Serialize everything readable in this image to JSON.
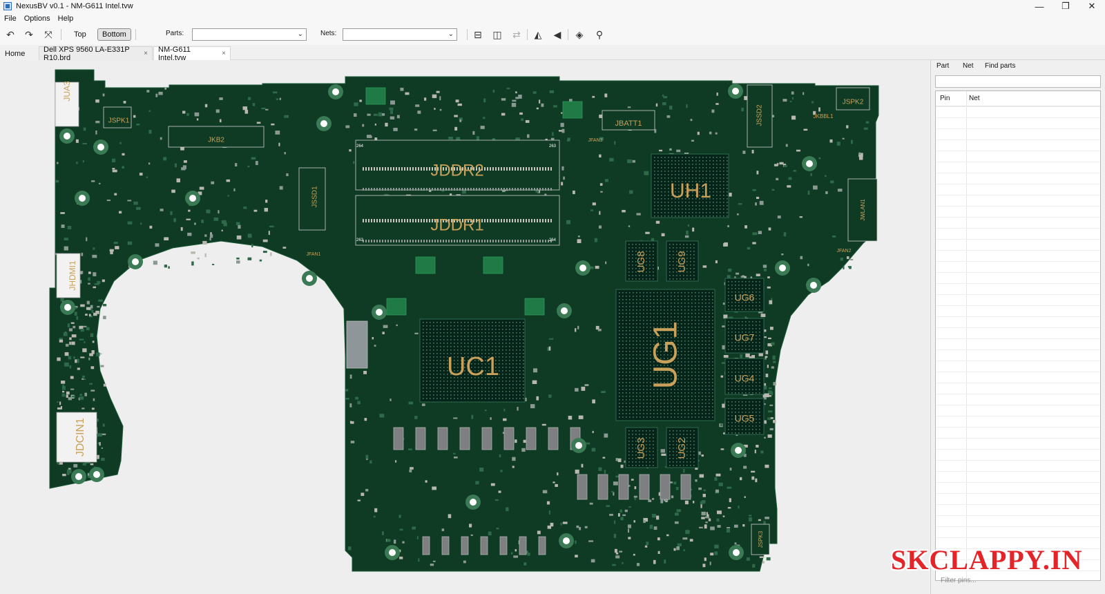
{
  "window": {
    "title": "NexusBV v0.1 - NM-G611 Intel.tvw",
    "minimize": "—",
    "maximize": "❐",
    "close": "✕"
  },
  "menu": [
    "File",
    "Options",
    "Help"
  ],
  "toolbar": {
    "undo_icon": "↶",
    "redo_icon": "↷",
    "fit_icon": "⤧",
    "top_label": "Top",
    "bottom_label": "Bottom",
    "parts_label": "Parts:",
    "parts_value": "",
    "nets_label": "Nets:",
    "nets_value": "",
    "icons": [
      "⊟",
      "◫",
      "⇄",
      "◭",
      "◀",
      "◈",
      "⚲"
    ]
  },
  "tabs": [
    {
      "label": "Home",
      "closable": false
    },
    {
      "label": "Dell XPS 9560 LA-E331P R10.brd",
      "closable": true
    },
    {
      "label": "NM-G611 Intel.tvw",
      "closable": true,
      "active": true
    }
  ],
  "board": {
    "colors": {
      "pcb": "#0f3b25",
      "silk": "#c9a15a",
      "component_dark": "#06251a",
      "bga_frame": "#2f6a4e",
      "hole_ring": "#3a7a55"
    },
    "labels": [
      "JUA3",
      "JSPK1",
      "JKB2",
      "JSSD1",
      "JFAN1",
      "JDDR2",
      "JDDR1",
      "JBATT1",
      "JFAN3",
      "UH1",
      "JSSD2",
      "JKBBL1",
      "JSPK2",
      "JWLAN1",
      "JFAN2",
      "JHDMI1",
      "JDCIN1",
      "UC1",
      "UG1",
      "UG8",
      "UG9",
      "UG6",
      "UG7",
      "UG4",
      "UG5",
      "UG3",
      "UG2",
      "JSPK3"
    ],
    "pin_marks": [
      "264",
      "263",
      "263",
      "264"
    ]
  },
  "right_panel": {
    "tabs": [
      "Part",
      "Net",
      "Find parts"
    ],
    "search_value": "",
    "columns": [
      "Pin",
      "Net"
    ],
    "filter_placeholder": "Filter pins..."
  },
  "watermark": "SKCLAPPY.IN"
}
